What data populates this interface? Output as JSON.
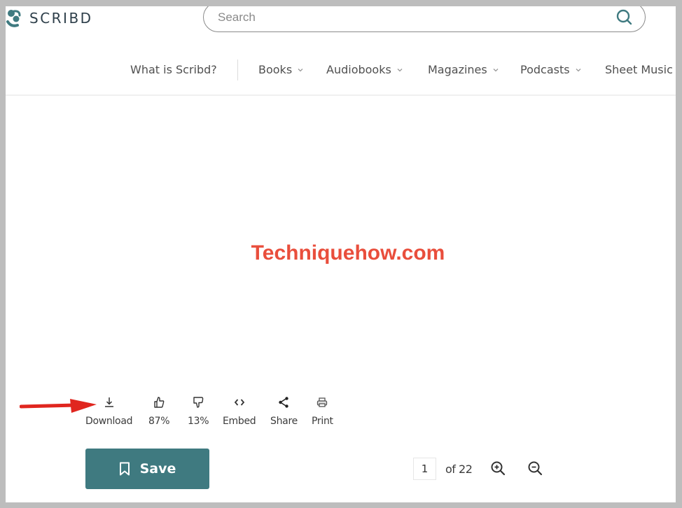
{
  "header": {
    "logo_text": "SCRIBD",
    "search": {
      "placeholder": "Search",
      "value": "",
      "icon": "search-icon"
    }
  },
  "nav": {
    "items": [
      {
        "label": "What is Scribd?",
        "has_dropdown": false
      },
      {
        "label": "Books",
        "has_dropdown": true
      },
      {
        "label": "Audiobooks",
        "has_dropdown": true
      },
      {
        "label": "Magazines",
        "has_dropdown": true
      },
      {
        "label": "Podcasts",
        "has_dropdown": true
      },
      {
        "label": "Sheet Music",
        "has_dropdown": false
      }
    ]
  },
  "document": {
    "watermark": "Techniquehow.com"
  },
  "toolbar": {
    "items": [
      {
        "label": "Download",
        "icon": "download-icon"
      },
      {
        "label": "87%",
        "icon": "thumbs-up-icon"
      },
      {
        "label": "13%",
        "icon": "thumbs-down-icon"
      },
      {
        "label": "Embed",
        "icon": "embed-code-icon"
      },
      {
        "label": "Share",
        "icon": "share-icon"
      },
      {
        "label": "Print",
        "icon": "print-icon"
      }
    ],
    "annotation_arrow_color": "#e0261f"
  },
  "footer": {
    "save_label": "Save",
    "save_color": "#3f7a80",
    "current_page": "1",
    "page_total_text": "of 22",
    "zoom_in_icon": "zoom-in-icon",
    "zoom_out_icon": "zoom-out-icon"
  },
  "colors": {
    "brand_teal": "#3f7a80",
    "watermark_red": "#e94e3c",
    "frame_grey": "#bdbdbd"
  }
}
